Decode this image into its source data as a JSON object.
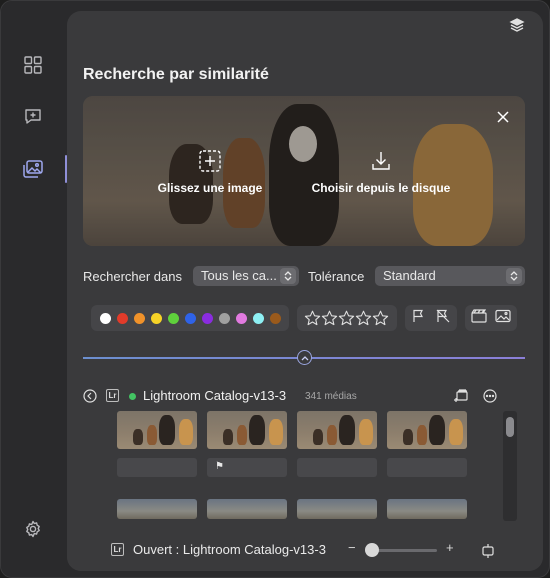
{
  "window": {
    "traffic_lights": [
      "close",
      "minimize",
      "zoom"
    ]
  },
  "sidebar": {
    "items": [
      {
        "icon": "grid-icon"
      },
      {
        "icon": "chat-add-icon"
      },
      {
        "icon": "photo-stack-icon",
        "active": true
      },
      {
        "icon": "gear-icon"
      }
    ]
  },
  "main": {
    "title": "Recherche par similarité",
    "hero": {
      "drop_label": "Glissez une image",
      "disk_label": "Choisir depuis le disque"
    },
    "search_in_label": "Rechercher dans",
    "search_in_value": "Tous les ca...",
    "tolerance_label": "Tolérance",
    "tolerance_value": "Standard",
    "color_filters": [
      "#ffffff",
      "#e23b2a",
      "#f0922a",
      "#f6d327",
      "#5fd13c",
      "#2f63e8",
      "#8a2ce0",
      "#a0a0a0",
      "#e27ae0",
      "#8ef0f4",
      "#9a5a1c"
    ],
    "rating_stars": 5
  },
  "catalog": {
    "badge": "Lr",
    "name": "Lightroom Catalog-v13-3",
    "count": "341 médias",
    "flag_glyph": "⚑"
  },
  "footer": {
    "badge": "Lr",
    "status": "Ouvert : Lightroom Catalog-v13-3",
    "zoom_minus": "−",
    "zoom_plus": "+"
  }
}
